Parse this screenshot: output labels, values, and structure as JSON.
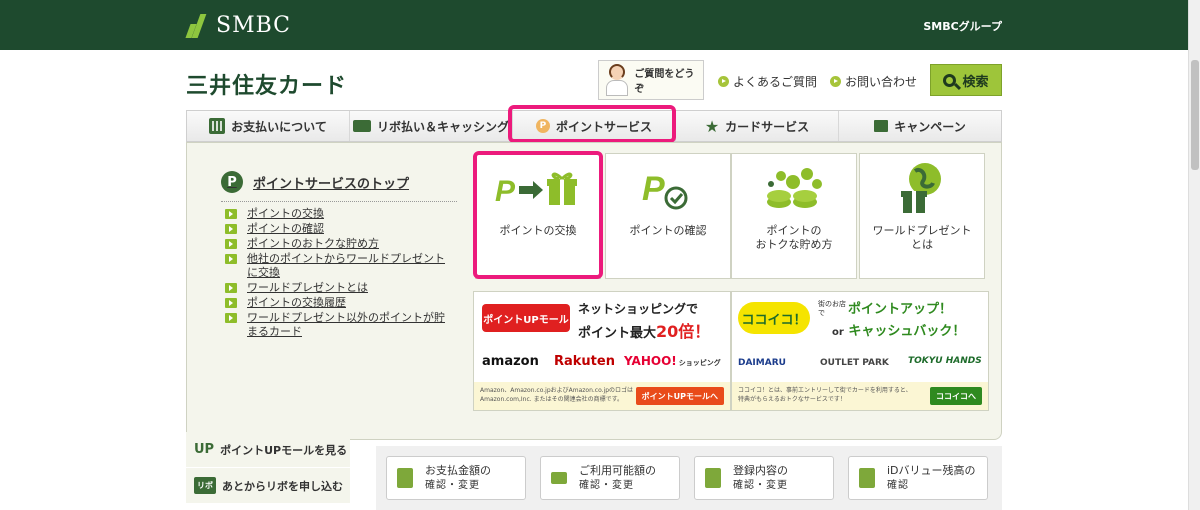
{
  "topbar": {
    "logo": "SMBC",
    "group": "SMBCグループ"
  },
  "header": {
    "brand": "三井住友カード",
    "qa_label": "ご質問をどうぞ",
    "faq": "よくあるご質問",
    "contact": "お問い合わせ",
    "search": "検索"
  },
  "nav": {
    "items": [
      {
        "label": "お支払いについて"
      },
      {
        "label": "リボ払い＆キャッシング"
      },
      {
        "label": "ポイントサービス"
      },
      {
        "label": "カードサービス"
      },
      {
        "label": "キャンペーン"
      }
    ]
  },
  "panel": {
    "top_link": "ポイントサービスのトップ",
    "links": [
      "ポイントの交換",
      "ポイントの確認",
      "ポイントのおトクな貯め方",
      "他社のポイントからワールドプレゼントに交換",
      "ワールドプレゼントとは",
      "ポイントの交換履歴",
      "ワールドプレゼント以外のポイントが貯まるカード"
    ],
    "tiles": [
      {
        "line1": "ポイントの交換",
        "line2": ""
      },
      {
        "line1": "ポイントの確認",
        "line2": ""
      },
      {
        "line1": "ポイントの",
        "line2": "おトクな貯め方"
      },
      {
        "line1": "ワールドプレゼント",
        "line2": "とは"
      }
    ],
    "banner1": {
      "badge": "ポイントUPモール",
      "headline1": "ネットショッピングで",
      "headline2a": "ポイント最大",
      "headline2b": "20倍！",
      "brand1": "amazon",
      "brand2": "Rakuten",
      "brand3": "YAHOO!",
      "brand3b": "ショッピング",
      "note": "Amazon、Amazon.co.jpおよびAmazon.co.jpのロゴは Amazon.com,Inc. またはその関連会社の商標です。",
      "cta": "ポイントUPモールへ"
    },
    "banner2": {
      "badge": "ココイコ！",
      "small": "街のお店で",
      "headline1": "ポイントアップ！",
      "headline2a": "or",
      "headline2b": "キャッシュバック！",
      "brand1": "DAIMARU",
      "brand2": "OUTLET PARK",
      "brand3": "TOKYU HANDS",
      "note": "ココイコ！とは、事前エントリーして街でカードを利用すると、特典がもらえるおトクなサービスです！",
      "cta": "ココイコへ"
    }
  },
  "left_menu": {
    "items": [
      {
        "badge": "UP",
        "label": "ポイントUPモールを見る"
      },
      {
        "badge": "リボ",
        "label": "あとからリボを申し込む"
      }
    ]
  },
  "quick": {
    "cards": [
      {
        "line1": "お支払金額の",
        "line2": "確認・変更"
      },
      {
        "line1": "ご利用可能額の",
        "line2": "確認・変更"
      },
      {
        "line1": "登録内容の",
        "line2": "確認・変更"
      },
      {
        "line1": "iDバリュー残高の",
        "line2": "確認"
      }
    ]
  },
  "colors": {
    "dark_green": "#1e4a2e",
    "accent_green": "#8ebd2a",
    "highlight": "#ec1a7c"
  }
}
